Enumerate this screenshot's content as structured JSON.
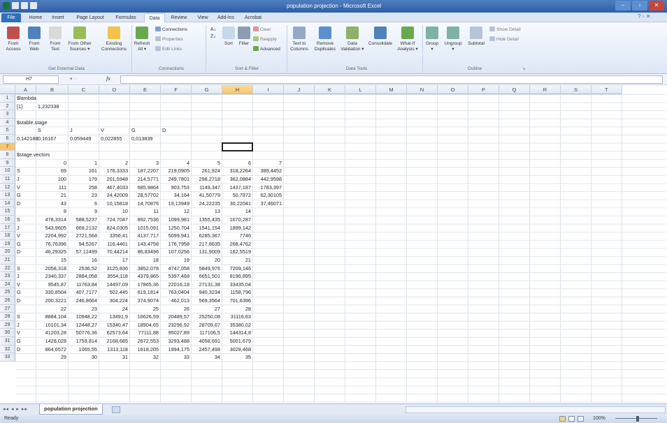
{
  "window": {
    "title": "population projection - Microsoft Excel"
  },
  "tabs": [
    "File",
    "Home",
    "Insert",
    "Page Layout",
    "Formulas",
    "Data",
    "Review",
    "View",
    "Add-Ins",
    "Acrobat"
  ],
  "ribbon": {
    "get_external": {
      "label": "Get External Data",
      "buttons": [
        "From\nAccess",
        "From\nWeb",
        "From\nText",
        "From Other\nSources ▾",
        "Existing\nConnections"
      ]
    },
    "connections": {
      "label": "Connections",
      "refresh": "Refresh\nAll ▾",
      "items": [
        "Connections",
        "Properties",
        "Edit Links"
      ]
    },
    "sort_filter": {
      "label": "Sort & Filter",
      "sort": "Sort",
      "filter": "Filter",
      "items": [
        "Clear",
        "Reapply",
        "Advanced"
      ]
    },
    "data_tools": {
      "label": "Data Tools",
      "buttons": [
        "Text to\nColumns",
        "Remove\nDuplicates",
        "Data\nValidation ▾",
        "Consolidate",
        "What-If\nAnalysis ▾"
      ]
    },
    "outline": {
      "label": "Outline",
      "buttons": [
        "Group\n▾",
        "Ungroup\n▾",
        "Subtotal"
      ],
      "items": [
        "Show Detail",
        "Hide Detail"
      ]
    }
  },
  "formula_bar": {
    "name_box": "H7",
    "fx": "fx"
  },
  "columns": [
    "A",
    "B",
    "C",
    "D",
    "E",
    "F",
    "G",
    "H",
    "I",
    "J",
    "K",
    "L",
    "M",
    "N",
    "O",
    "P",
    "Q",
    "R",
    "S",
    "T"
  ],
  "rows": [
    "1",
    "2",
    "3",
    "4",
    "5",
    "6",
    "7",
    "8",
    "9",
    "10",
    "11",
    "12",
    "13",
    "14",
    "15",
    "16",
    "17",
    "18",
    "19",
    "20",
    "21",
    "22",
    "23",
    "24",
    "25",
    "26",
    "27",
    "28",
    "29",
    "30",
    "31",
    "32",
    "33"
  ],
  "cells": [
    [
      "$lambda"
    ],
    [
      "[1]",
      "1,232338"
    ],
    [],
    [
      "$stable.stage"
    ],
    [
      "",
      "S",
      "J",
      "V",
      "G",
      "D"
    ],
    [
      "0,142188",
      "0,16167",
      "0,059449",
      "0,022855",
      "0,013839"
    ],
    [],
    [
      "$stage.vectors"
    ],
    [
      "",
      "0",
      "1",
      "2",
      "3",
      "4",
      "5",
      "6",
      "7"
    ],
    [
      "S",
      "69",
      "161",
      "176,3333",
      "187,2207",
      "219,0905",
      "261,924",
      "318,2264",
      "389,4452"
    ],
    [
      "J",
      "100",
      "179",
      "201,5948",
      "214,5771",
      "249,7801",
      "298,2718",
      "362,0884",
      "442,9598"
    ],
    [
      "V",
      "111",
      "258",
      "467,4033",
      "685,9864",
      "903,753",
      "1149,347",
      "1437,187",
      "1783,397"
    ],
    [
      "G",
      "21",
      "23",
      "24,42009",
      "28,57702",
      "34,164",
      "41,50779",
      "50,7972",
      "62,30105"
    ],
    [
      "D",
      "43",
      "6",
      "10,15818",
      "14,70876",
      "19,13949",
      "24,22235",
      "30,22041",
      "37,46071"
    ],
    [
      "",
      "8",
      "9",
      "10",
      "11",
      "12",
      "13",
      "14"
    ],
    [
      "S",
      "478,3314",
      "588,5237",
      "724,7047",
      "892,7536",
      "1099,981",
      "1355,435",
      "1670,287"
    ],
    [
      "J",
      "543,9605",
      "669,2132",
      "824,0305",
      "1015,091",
      "1250,704",
      "1541,154",
      "1899,142"
    ],
    [
      "V",
      "2204,992",
      "2721,568",
      "3356,41",
      "4137,717",
      "5099,941",
      "6285,367",
      "7746"
    ],
    [
      "G",
      "76,76396",
      "94,5267",
      "116,4461",
      "143,4758",
      "176,7958",
      "217,8635",
      "268,4762"
    ],
    [
      "D",
      "46,29325",
      "57,12499",
      "70,44214",
      "86,83496",
      "107,0256",
      "131,9009",
      "162,5519"
    ],
    [
      "",
      "15",
      "16",
      "17",
      "18",
      "19",
      "20",
      "21"
    ],
    [
      "S",
      "2058,318",
      "2536,52",
      "3125,836",
      "3852,078",
      "4747,058",
      "5849,976",
      "7209,146"
    ],
    [
      "J",
      "2340,337",
      "2884,058",
      "3554,118",
      "4379,865",
      "5397,468",
      "6651,501",
      "8196,895"
    ],
    [
      "V",
      "9545,87",
      "11763,84",
      "14497,09",
      "17865,36",
      "22016,18",
      "27131,38",
      "33435,04"
    ],
    [
      "G",
      "330,8504",
      "407,7177",
      "502,445",
      "619,1814",
      "763,0404",
      "940,3234",
      "1158,796"
    ],
    [
      "D",
      "200,3221",
      "246,8664",
      "304,224",
      "374,9074",
      "462,013",
      "569,3564",
      "701,6396"
    ],
    [
      "",
      "22",
      "23",
      "24",
      "25",
      "26",
      "27",
      "28"
    ],
    [
      "S",
      "8884,104",
      "10948,22",
      "13491,9",
      "16626,59",
      "20489,57",
      "25250,08",
      "31116,63"
    ],
    [
      "J",
      "10101,34",
      "12448,27",
      "15340,47",
      "18904,65",
      "23296,92",
      "28709,67",
      "35380,02"
    ],
    [
      "V",
      "41203,28",
      "50776,36",
      "62573,64",
      "77111,88",
      "95027,89",
      "117106,5",
      "144314,8"
    ],
    [
      "G",
      "1428,028",
      "1759,814",
      "2168,685",
      "2672,553",
      "3293,488",
      "4058,691",
      "5001,679"
    ],
    [
      "D",
      "864,6572",
      "1065,55",
      "1313,118",
      "1618,205",
      "1994,175",
      "2457,498",
      "3028,468"
    ],
    [
      "",
      "29",
      "30",
      "31",
      "32",
      "33",
      "34",
      "35"
    ]
  ],
  "selected_cell": {
    "col": "H",
    "row": "7"
  },
  "sheet_tab": "population projection",
  "status": {
    "ready": "Ready",
    "zoom": "100%"
  },
  "colors": {
    "accent": "#2f6fb8",
    "selection_header": "#f5c66a"
  }
}
